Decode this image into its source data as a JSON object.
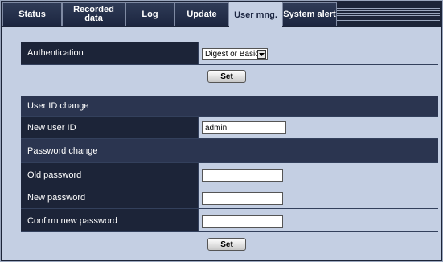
{
  "tabs": [
    {
      "label": "Status"
    },
    {
      "label": "Recorded data"
    },
    {
      "label": "Log"
    },
    {
      "label": "Update"
    },
    {
      "label": "User mng."
    },
    {
      "label": "System alert"
    }
  ],
  "authentication": {
    "label": "Authentication",
    "selected": "Digest or Basic",
    "set_label": "Set"
  },
  "user_id_change": {
    "heading": "User ID change",
    "new_user_id_label": "New user ID",
    "new_user_id_value": "admin"
  },
  "password_change": {
    "heading": "Password change",
    "old_password_label": "Old password",
    "old_password_value": "",
    "new_password_label": "New password",
    "new_password_value": "",
    "confirm_password_label": "Confirm new password",
    "confirm_password_value": "",
    "set_label": "Set"
  },
  "colors": {
    "background": "#1c2438",
    "panel": "#c4cfe3",
    "active_tab": "#c4cfe3"
  },
  "icons": {
    "select_arrow": "chevron-down-icon"
  }
}
